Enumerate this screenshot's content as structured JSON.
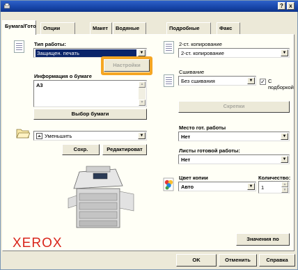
{
  "window": {
    "help_label": "?",
    "close_label": "x"
  },
  "tabs": [
    {
      "label": "Бумага/Гото"
    },
    {
      "label": "Опции"
    },
    {
      "label": "Макет"
    },
    {
      "label": "Водяные"
    },
    {
      "label": "Подробные"
    },
    {
      "label": "Факс"
    }
  ],
  "left": {
    "job_type_label": "Тип работы:",
    "job_type_value": "Защищен. печать",
    "settings_button": "Настройки",
    "paper_info_label": "Информация о бумаге",
    "paper_info_value": "A3",
    "select_paper_button": "Выбор бумаги",
    "reduce_value": "Уменьшить",
    "save_button": "Сохр.",
    "edit_button": "Редактироват",
    "logo": "XEROX"
  },
  "right": {
    "duplex_label": "2-ст. копирование",
    "duplex_value": "2-ст. копирование",
    "stapling_label": "Сшивание",
    "stapling_value": "Без сшивания",
    "collate_label": "С подборкой",
    "staples_button": "Скрепки",
    "output_label": "Место гот. работы",
    "output_value": "Нет",
    "finished_sheets_label": "Листы готовой работы:",
    "finished_sheets_value": "Нет",
    "copy_color_label": "Цвет копии",
    "copy_color_value": "Авто",
    "quantity_label": "Количество:",
    "quantity_value": "1",
    "defaults_button": "Значения по"
  },
  "footer": {
    "ok": "OK",
    "cancel": "Отменить",
    "help": "Справка"
  },
  "colors": {
    "highlight": "#f5a623",
    "xerox_red": "#d9261c",
    "selection": "#0a246a"
  }
}
